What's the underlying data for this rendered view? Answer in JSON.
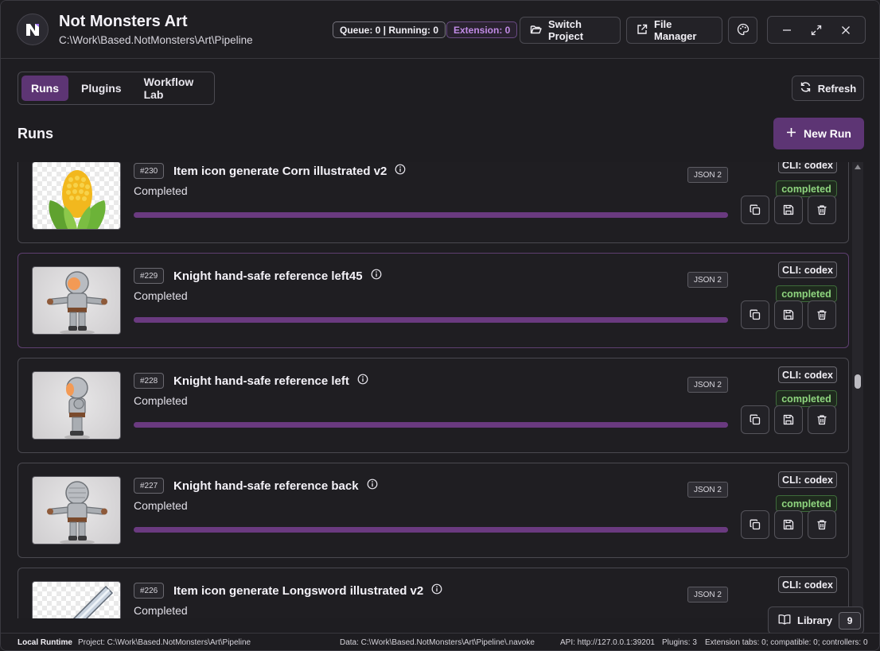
{
  "app": {
    "title": "Not Monsters Art",
    "path": "C:\\Work\\Based.NotMonsters\\Art\\Pipeline"
  },
  "header": {
    "queue_status": "Queue: 0 | Running: 0",
    "extension_status": "Extension: 0",
    "switch_project_label": "Switch Project",
    "file_manager_label": "File Manager"
  },
  "tabs": [
    {
      "label": "Runs",
      "active": true
    },
    {
      "label": "Plugins",
      "active": false
    },
    {
      "label": "Workflow Lab",
      "active": false
    }
  ],
  "toolbar": {
    "refresh_label": "Refresh",
    "new_run_label": "New Run"
  },
  "section_title": "Runs",
  "runs": [
    {
      "id": "#230",
      "title": "Item icon generate Corn illustrated v2",
      "status": "Completed",
      "json": "JSON 2",
      "cli": "CLI: codex",
      "state": "completed",
      "progress": 1.0,
      "thumb": "corn"
    },
    {
      "id": "#229",
      "title": "Knight hand-safe reference left45",
      "status": "Completed",
      "json": "JSON 2",
      "cli": "CLI: codex",
      "state": "completed",
      "progress": 1.0,
      "thumb": "knight-left45"
    },
    {
      "id": "#228",
      "title": "Knight hand-safe reference left",
      "status": "Completed",
      "json": "JSON 2",
      "cli": "CLI: codex",
      "state": "completed",
      "progress": 1.0,
      "thumb": "knight-left"
    },
    {
      "id": "#227",
      "title": "Knight hand-safe reference back",
      "status": "Completed",
      "json": "JSON 2",
      "cli": "CLI: codex",
      "state": "completed",
      "progress": 1.0,
      "thumb": "knight-back"
    },
    {
      "id": "#226",
      "title": "Item icon generate Longsword illustrated v2",
      "status": "Completed",
      "json": "JSON 2",
      "cli": "CLI: codex",
      "state": "",
      "progress": 1.0,
      "thumb": "longsword"
    }
  ],
  "library": {
    "label": "Library",
    "count": "9"
  },
  "statusbar": {
    "runtime": "Local Runtime",
    "project": "Project: C:\\Work\\Based.NotMonsters\\Art\\Pipeline",
    "data": "Data: C:\\Work\\Based.NotMonsters\\Art\\Pipeline\\.navoke",
    "api": "API: http://127.0.0.1:39201",
    "plugins": "Plugins: 3",
    "extensions": "Extension tabs: 0; compatible: 0; controllers: 0"
  },
  "colors": {
    "accent": "#5d3574",
    "progress": "#6a3a80",
    "completed_text": "#8fd67f",
    "background": "#1e1d21"
  },
  "icons": {
    "switch_project": "folder-open-icon",
    "file_manager": "external-link-icon",
    "palette": "palette-icon",
    "refresh": "refresh-icon",
    "new_run": "plus-icon",
    "info": "info-icon",
    "copy": "copy-icon",
    "save": "save-icon",
    "delete": "trash-icon",
    "library": "book-icon"
  }
}
